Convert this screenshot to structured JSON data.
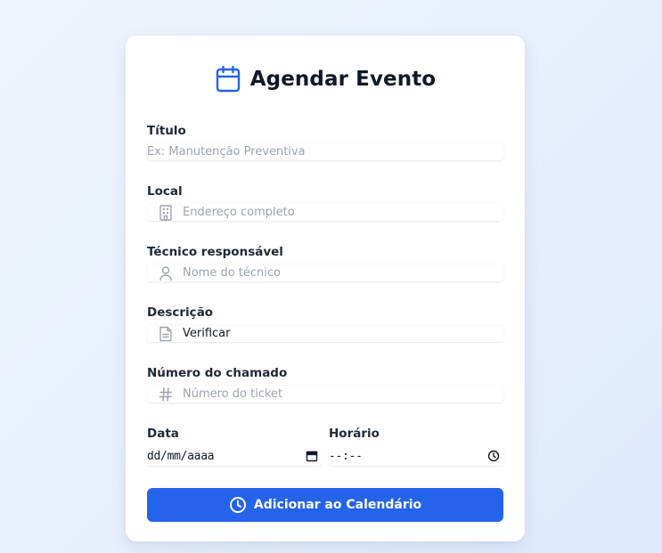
{
  "form": {
    "title": "Agendar Evento",
    "fields": {
      "titulo": {
        "label": "Título",
        "placeholder": "Ex: Manutenção Preventiva",
        "value": ""
      },
      "local": {
        "label": "Local",
        "placeholder": "Endereço completo",
        "value": "",
        "icon": "building-icon"
      },
      "tecnico": {
        "label": "Técnico responsável",
        "placeholder": "Nome do técnico",
        "value": "",
        "icon": "user-icon"
      },
      "descricao": {
        "label": "Descrição",
        "placeholder": "",
        "value": "Verificar",
        "icon": "document-icon"
      },
      "chamado": {
        "label": "Número do chamado",
        "placeholder": "Número do ticket",
        "value": "",
        "icon": "hash-icon"
      },
      "data": {
        "label": "Data",
        "value": "dd/mm/aaaa",
        "icon": "calendar-icon"
      },
      "horario": {
        "label": "Horário",
        "value": "--:--",
        "icon": "clock-icon"
      }
    },
    "submit_label": "Adicionar ao Calendário",
    "submit_icon": "clock-icon"
  },
  "colors": {
    "accent": "#2563eb",
    "title": "#111827",
    "placeholder": "#9ca3af",
    "icon": "#9ca3af"
  }
}
